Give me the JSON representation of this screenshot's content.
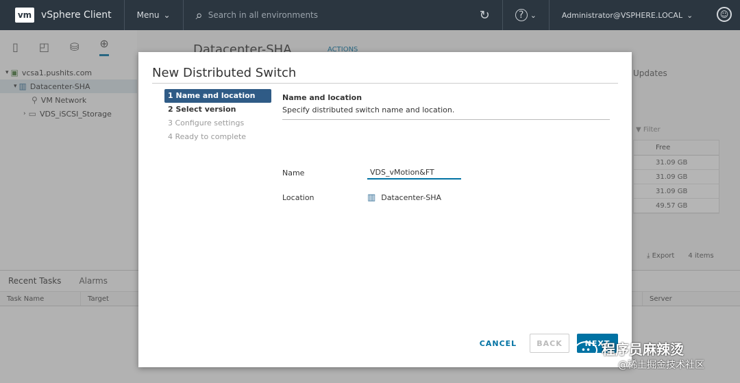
{
  "topbar": {
    "logo": "vm",
    "app_title": "vSphere Client",
    "menu_label": "Menu",
    "search_placeholder": "Search in all environments",
    "user": "Administrator@VSPHERE.LOCAL"
  },
  "navigator": {
    "tree": [
      {
        "label": "vcsa1.pushits.com",
        "icon": "vcenter-icon"
      },
      {
        "label": "Datacenter-SHA",
        "icon": "datacenter-icon"
      },
      {
        "label": "VM Network",
        "icon": "network-icon"
      },
      {
        "label": "VDS_iSCSI_Storage",
        "icon": "distributed-switch-icon"
      }
    ]
  },
  "background": {
    "title": "Datacenter-SHA",
    "actions": "ACTIONS",
    "updates_tab": "Updates",
    "filter_placeholder": "Filter",
    "table_header": "Free",
    "table_rows": [
      "31.09 GB",
      "31.09 GB",
      "31.09 GB",
      "49.57 GB"
    ],
    "export": "Export",
    "items_count": "4 items"
  },
  "bottom_panel": {
    "tabs": [
      "Recent Tasks",
      "Alarms"
    ],
    "columns": [
      "Task Name",
      "Target",
      "Server"
    ]
  },
  "dialog": {
    "title": "New Distributed Switch",
    "steps": [
      {
        "label": "1 Name and location",
        "state": "active"
      },
      {
        "label": "2 Select version",
        "state": "enabled"
      },
      {
        "label": "3 Configure settings",
        "state": "disabled"
      },
      {
        "label": "4 Ready to complete",
        "state": "disabled"
      }
    ],
    "section_title": "Name and location",
    "section_desc": "Specify distributed switch name and location.",
    "name_label": "Name",
    "name_value": "VDS_vMotion&FT",
    "location_label": "Location",
    "location_value": "Datacenter-SHA",
    "cancel": "CANCEL",
    "back": "BACK",
    "next": "NEXT"
  },
  "watermark": {
    "main": "程序员麻辣烫",
    "sub": "@稀土掘金技术社区"
  }
}
